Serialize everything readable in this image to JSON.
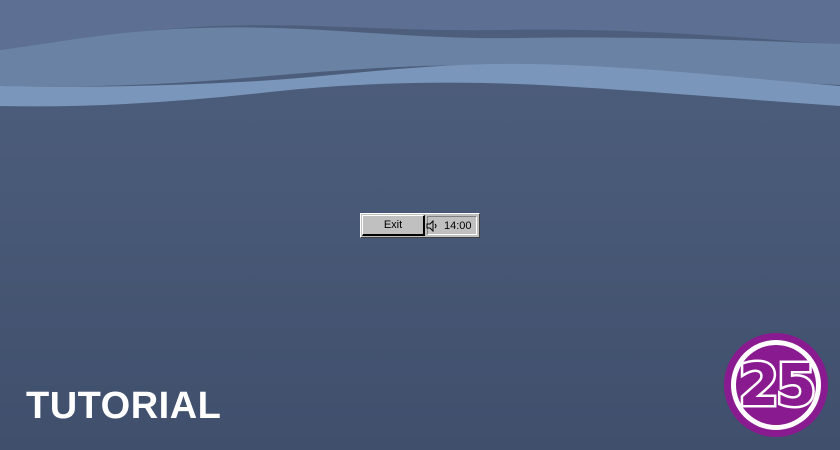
{
  "desktop": {
    "colors": {
      "background_top": "#4e5f7d",
      "background_bottom": "#3f4f6c",
      "wave_back": "#5d7093",
      "wave_mid": "#6a82a3",
      "wave_front": "#7a97bb"
    }
  },
  "taskbar": {
    "exit_label": "Exit",
    "clock": "14:00",
    "tray_icon": "speaker-icon"
  },
  "overlay": {
    "tutorial_label": "TUTORIAL",
    "logo_number": "25",
    "logo_icon": "circle-number-logo",
    "logo_color": "#8a1a8f"
  }
}
